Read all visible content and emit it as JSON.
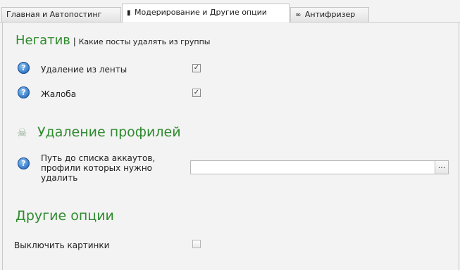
{
  "tabs": [
    {
      "label": "Главная и Автопостинг",
      "glyph": ""
    },
    {
      "label": "Модерирование и Другие опции",
      "glyph": "▮"
    },
    {
      "label": "Антифризер",
      "glyph": "∞"
    }
  ],
  "negative": {
    "title": "Негатив",
    "separator": "|",
    "subtitle": "Какие посты удалять из группы",
    "options": [
      {
        "label": "Удаление из ленты",
        "checked": true,
        "mark": "✓"
      },
      {
        "label": "Жалоба",
        "checked": true,
        "mark": "✓"
      }
    ]
  },
  "profiles": {
    "icon": "skull-crossbones-icon",
    "glyph": "☠",
    "title": "Удаление профилей",
    "path_label": "Путь до списка аккаутов, профили которых нужно удалить",
    "path_value": "",
    "browse_label": "..."
  },
  "other": {
    "title": "Другие опции",
    "options": [
      {
        "label": "Выключить картинки",
        "checked": false
      }
    ]
  },
  "help_glyph": "?",
  "colors": {
    "accent_green": "#2e8b2e",
    "help_blue": "#2f74c5"
  }
}
